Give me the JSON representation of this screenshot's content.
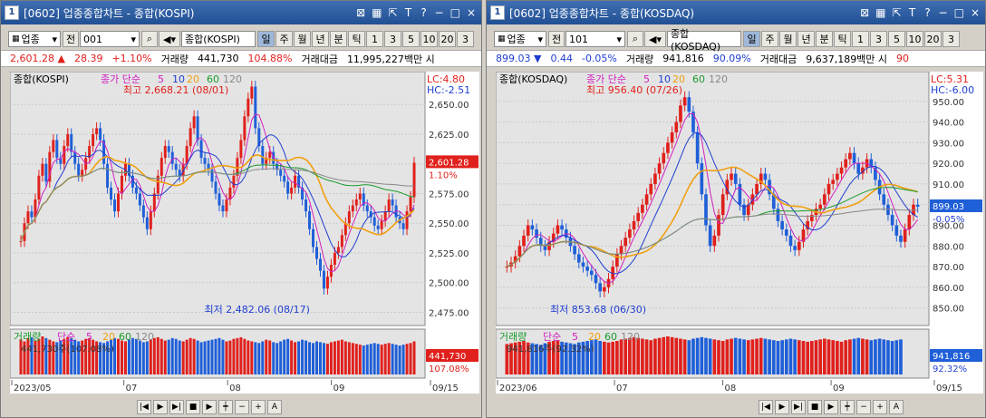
{
  "windows": [
    {
      "title": "[0602] 업종종합차트 - 종합(KOSPI)",
      "num": "1",
      "title_icons": [
        "pin-icon",
        "expand-icon",
        "T",
        "?",
        "-",
        "□",
        "×"
      ],
      "toolbar": {
        "market": "업종",
        "prev": "전",
        "code": "001",
        "name": "종합(KOSPI)",
        "periods": [
          "일",
          "주",
          "월",
          "년",
          "분",
          "틱",
          "1",
          "3",
          "5",
          "10",
          "20",
          "3"
        ]
      },
      "quote": {
        "price": "2,601.28",
        "change": "28.39",
        "pct": "+1.10%",
        "vol_label": "거래량",
        "vol": "441,730",
        "vol_pct": "104.88%",
        "amt_label": "거래대금",
        "amt": "11,995,227백만 시"
      },
      "legend": {
        "name": "종합(KOSPI)",
        "ma_label": "종가 단순",
        "ma": [
          "5",
          "10",
          "20",
          "60",
          "120"
        ],
        "ma_colors": [
          "#d020c0",
          "#1f3fd0",
          "#f0a010",
          "#1a9a2a",
          "#888888"
        ]
      },
      "info": {
        "lc": "LC:4.80",
        "hc": "HC:-2.51"
      },
      "high_ann": "최고 2,668.21 (08/01)",
      "low_ann": "최저 2,482.06 (08/17)",
      "price_tag": "2,601.28",
      "price_tag_pct": "1.10%",
      "y_ticks": [
        "2,650.00",
        "2,625.00",
        "2,600.00",
        "2,575.00",
        "2,550.00",
        "2,525.00",
        "2,500.00",
        "2,475.00"
      ],
      "vol_legend": {
        "label": "거래량",
        "ma_label": "단순",
        "ma": [
          "5",
          "20",
          "60",
          "120"
        ],
        "value": "441,730주(107.08%)"
      },
      "vol_tag": "441,730",
      "vol_tag_pct": "107.08%",
      "x_labels": [
        "2023/05",
        "07",
        "08",
        "09",
        "09/15"
      ]
    },
    {
      "title": "[0602] 업종종합차트 - 종합(KOSDAQ)",
      "num": "1",
      "title_icons": [
        "pin-icon",
        "expand-icon",
        "T",
        "?",
        "-",
        "□",
        "×"
      ],
      "toolbar": {
        "market": "업종",
        "prev": "전",
        "code": "101",
        "name": "종합(KOSDAQ)",
        "periods": [
          "일",
          "주",
          "월",
          "년",
          "분",
          "틱",
          "1",
          "3",
          "5",
          "10",
          "20",
          "3"
        ]
      },
      "quote": {
        "price": "899.03",
        "change": "0.44",
        "pct": "-0.05%",
        "vol_label": "거래량",
        "vol": "941,816",
        "vol_pct": "90.09%",
        "amt_label": "거래대금",
        "amt": "9,637,189백만 시",
        "extra": "90"
      },
      "legend": {
        "name": "종합(KOSDAQ)",
        "ma_label": "종가 단순",
        "ma": [
          "5",
          "10",
          "20",
          "60",
          "120"
        ],
        "ma_colors": [
          "#d020c0",
          "#1f3fd0",
          "#f0a010",
          "#1a9a2a",
          "#888888"
        ]
      },
      "info": {
        "lc": "LC:5.31",
        "hc": "HC:-6.00"
      },
      "high_ann": "최고 956.40 (07/26)",
      "low_ann": "최저 853.68 (06/30)",
      "price_tag": "899.03",
      "price_tag_pct": "-0.05%",
      "y_ticks": [
        "950.00",
        "940.00",
        "930.00",
        "920.00",
        "910.00",
        "900.00",
        "890.00",
        "880.00",
        "870.00",
        "860.00",
        "850.00"
      ],
      "vol_legend": {
        "label": "거래량",
        "ma_label": "단순",
        "ma": [
          "5",
          "20",
          "60",
          "120"
        ],
        "value": "941,816주(92.32%)"
      },
      "vol_tag": "941,816",
      "vol_tag_pct": "92.32%",
      "x_labels": [
        "2023/06",
        "07",
        "08",
        "09",
        "09/15"
      ]
    }
  ],
  "chart_data": [
    {
      "type": "candlestick",
      "title": "종합(KOSPI)",
      "ylim": [
        2470,
        2670
      ],
      "closes": [
        2535,
        2550,
        2560,
        2555,
        2570,
        2590,
        2600,
        2585,
        2610,
        2620,
        2605,
        2600,
        2615,
        2625,
        2610,
        2600,
        2590,
        2595,
        2605,
        2615,
        2625,
        2630,
        2620,
        2600,
        2580,
        2570,
        2560,
        2575,
        2590,
        2600,
        2590,
        2580,
        2575,
        2565,
        2555,
        2545,
        2560,
        2575,
        2590,
        2605,
        2615,
        2610,
        2600,
        2595,
        2590,
        2600,
        2615,
        2630,
        2640,
        2620,
        2605,
        2600,
        2595,
        2585,
        2575,
        2565,
        2560,
        2570,
        2580,
        2590,
        2605,
        2620,
        2640,
        2655,
        2665,
        2630,
        2615,
        2600,
        2605,
        2610,
        2600,
        2595,
        2590,
        2585,
        2575,
        2580,
        2590,
        2580,
        2570,
        2560,
        2545,
        2530,
        2520,
        2510,
        2495,
        2505,
        2515,
        2525,
        2530,
        2540,
        2550,
        2560,
        2565,
        2570,
        2575,
        2565,
        2560,
        2555,
        2548,
        2545,
        2552,
        2560,
        2570,
        2565,
        2555,
        2550,
        2545,
        2560,
        2572,
        2601
      ],
      "vol_values": [
        85,
        80,
        88,
        90,
        82,
        86,
        92,
        88,
        84,
        80,
        78,
        82,
        86,
        90,
        88,
        84,
        80,
        82,
        86,
        88,
        84,
        80,
        78,
        76,
        80,
        84,
        88,
        86,
        82,
        80,
        84,
        88,
        86,
        82,
        78,
        80,
        84,
        88,
        90,
        86,
        82,
        84,
        88,
        86,
        82,
        80,
        84,
        88,
        86,
        82,
        78,
        80,
        82,
        84,
        86,
        88,
        84,
        80,
        82,
        86,
        88,
        90,
        86,
        82,
        80,
        78,
        76,
        80,
        84,
        82,
        78,
        76,
        80,
        84,
        86,
        82,
        78,
        80,
        84,
        82,
        78,
        76,
        80,
        78,
        76,
        74,
        78,
        80,
        82,
        84,
        80,
        78,
        76,
        74,
        72,
        70,
        72,
        74,
        76,
        74,
        72,
        74,
        76,
        74,
        72,
        70,
        72,
        74,
        76,
        80
      ]
    },
    {
      "type": "candlestick",
      "title": "종합(KOSDAQ)",
      "ylim": [
        845,
        960
      ],
      "closes": [
        870,
        872,
        875,
        880,
        885,
        890,
        888,
        884,
        880,
        878,
        882,
        886,
        890,
        888,
        884,
        880,
        876,
        872,
        870,
        868,
        866,
        862,
        858,
        860,
        864,
        870,
        876,
        880,
        884,
        888,
        892,
        896,
        900,
        905,
        910,
        915,
        920,
        925,
        930,
        935,
        940,
        948,
        952,
        945,
        935,
        920,
        905,
        890,
        880,
        885,
        895,
        905,
        912,
        915,
        910,
        900,
        895,
        900,
        905,
        910,
        915,
        912,
        905,
        898,
        892,
        888,
        885,
        880,
        878,
        882,
        888,
        892,
        895,
        898,
        900,
        905,
        910,
        912,
        915,
        918,
        922,
        925,
        920,
        915,
        918,
        922,
        918,
        912,
        905,
        900,
        895,
        890,
        885,
        882,
        888,
        895,
        900,
        899
      ],
      "vol_values": [
        80,
        82,
        84,
        86,
        88,
        84,
        82,
        80,
        78,
        82,
        86,
        88,
        90,
        86,
        84,
        82,
        80,
        84,
        86,
        88,
        90,
        92,
        88,
        86,
        84,
        86,
        88,
        92,
        94,
        96,
        98,
        96,
        94,
        92,
        90,
        94,
        96,
        98,
        100,
        98,
        96,
        94,
        92,
        90,
        94,
        96,
        98,
        96,
        94,
        92,
        90,
        88,
        92,
        94,
        96,
        94,
        92,
        90,
        92,
        94,
        96,
        94,
        92,
        90,
        88,
        90,
        92,
        94,
        92,
        90,
        88,
        86,
        88,
        90,
        92,
        94,
        92,
        90,
        88,
        86,
        90,
        92,
        94,
        96,
        94,
        92,
        90,
        92,
        94,
        92,
        90,
        88,
        90,
        92
      ]
    }
  ]
}
